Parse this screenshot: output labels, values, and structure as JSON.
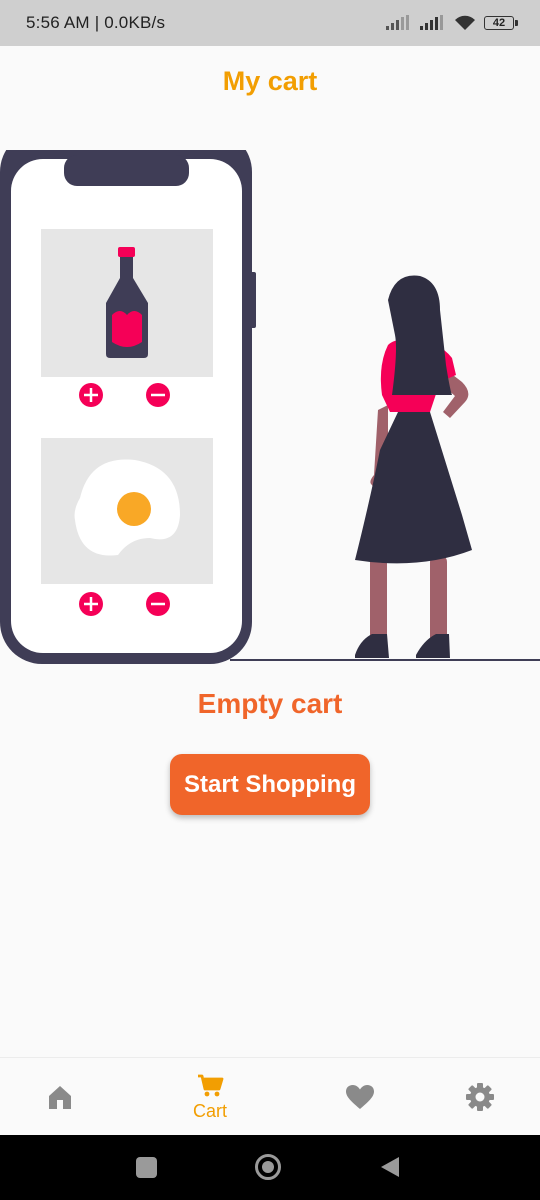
{
  "status_bar": {
    "text": "5:56 AM | 0.0KB/s",
    "battery": "42"
  },
  "header": {
    "title": "My cart"
  },
  "illustration": {
    "icons": [
      "phone-icon",
      "ketchup-bottle-icon",
      "fried-egg-icon",
      "plus-icon",
      "minus-icon",
      "woman-icon"
    ]
  },
  "empty_state": {
    "message": "Empty cart",
    "button_label": "Start Shopping"
  },
  "bottom_nav": {
    "items": [
      {
        "id": "home",
        "label": "",
        "icon": "home-icon",
        "active": false
      },
      {
        "id": "cart",
        "label": "Cart",
        "icon": "cart-icon",
        "active": true
      },
      {
        "id": "favorites",
        "label": "",
        "icon": "heart-icon",
        "active": false
      },
      {
        "id": "settings",
        "label": "",
        "icon": "gear-icon",
        "active": false
      }
    ]
  },
  "colors": {
    "accent_yellow": "#F29E02",
    "accent_orange": "#F0652A",
    "status_bar_bg": "#CFCFCF",
    "phone_frame": "#3F3D56",
    "pink": "#F50057",
    "inactive_icon": "#8A8A8A"
  }
}
